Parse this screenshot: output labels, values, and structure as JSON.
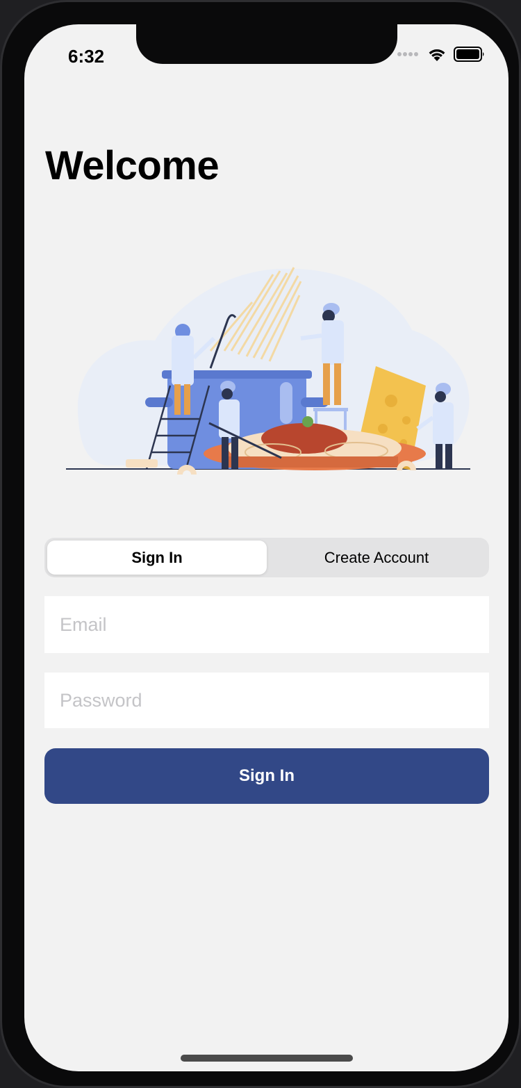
{
  "status_bar": {
    "time": "6:32",
    "icons": [
      "cellular-dots-icon",
      "wifi-icon",
      "battery-icon"
    ]
  },
  "header": {
    "title": "Welcome"
  },
  "illustration": {
    "subject": "chefs-cooking-pasta-illustration"
  },
  "auth_mode": {
    "options": [
      "Sign In",
      "Create Account"
    ],
    "selected": "Sign In"
  },
  "form": {
    "email_placeholder": "Email",
    "password_placeholder": "Password",
    "submit_label": "Sign In"
  },
  "colors": {
    "background": "#f2f2f2",
    "accent": "#324887",
    "field_background": "#ffffff",
    "segment_track": "#e3e3e4"
  }
}
